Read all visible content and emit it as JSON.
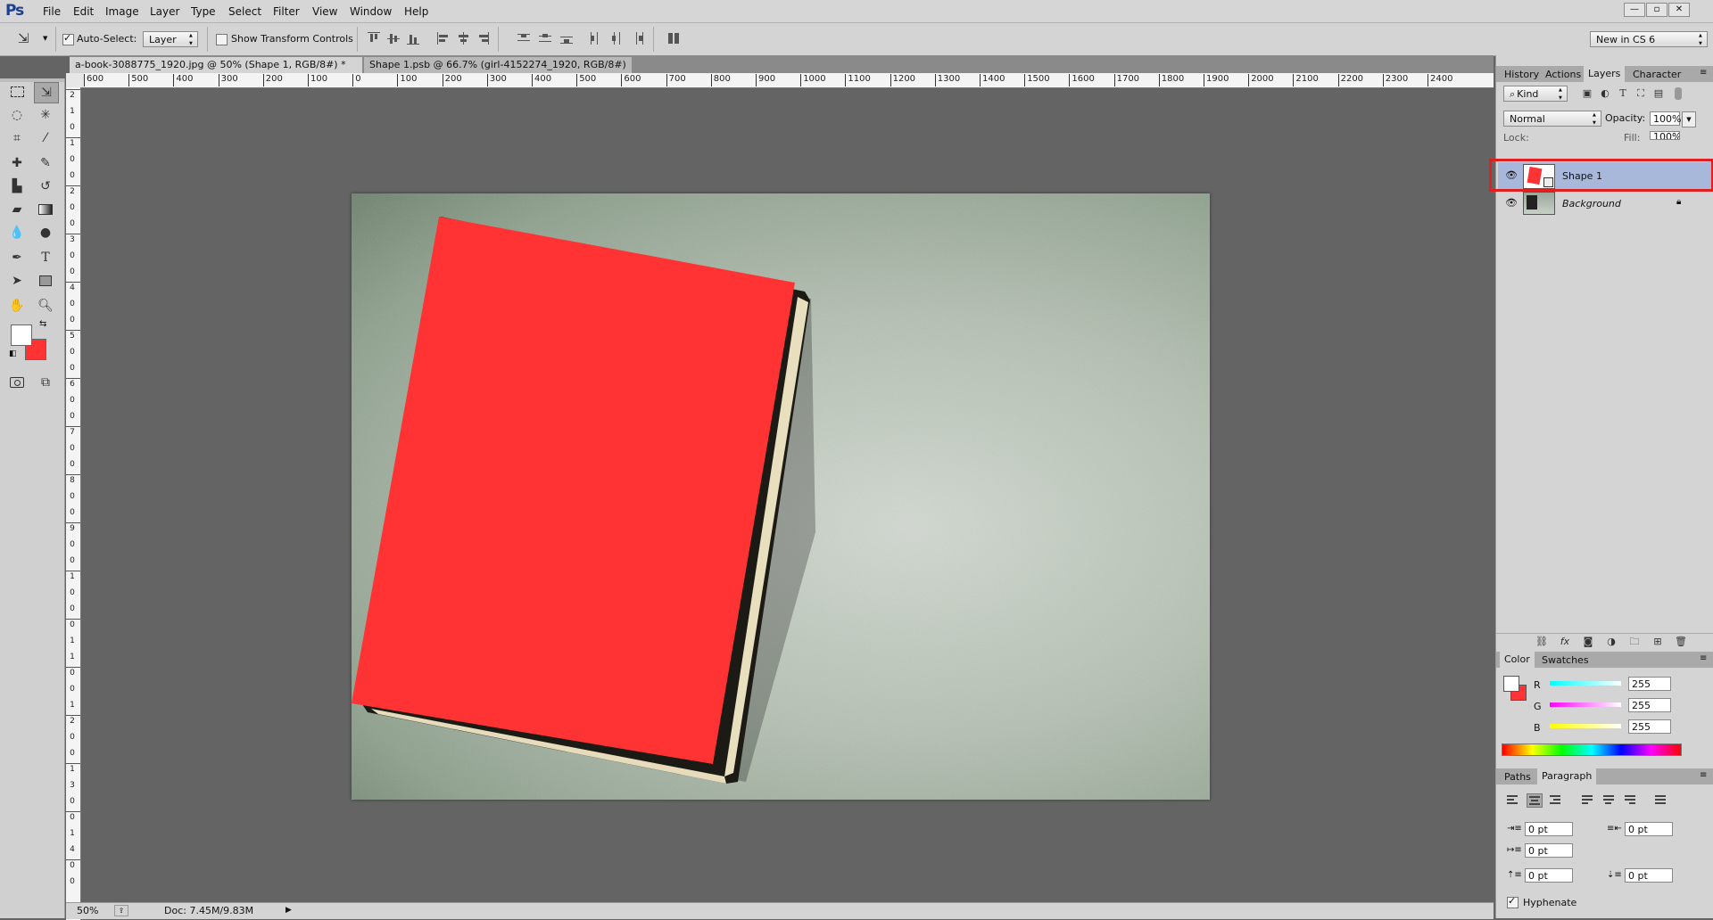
{
  "app": {
    "logo": "Ps"
  },
  "menu": [
    "File",
    "Edit",
    "Image",
    "Layer",
    "Type",
    "Select",
    "Filter",
    "View",
    "Window",
    "Help"
  ],
  "window_controls": [
    "—",
    "▫",
    "✕"
  ],
  "options": {
    "auto_select_label": "Auto-Select:",
    "auto_select_value": "Layer",
    "transform_label": "Show Transform Controls",
    "workspace": "New in CS 6"
  },
  "tabs": [
    {
      "label": "a-book-3088775_1920.jpg @ 50% (Shape 1, RGB/8#) *",
      "close": "×",
      "active": true
    },
    {
      "label": "Shape 1.psb @ 66.7% (girl-4152274_1920, RGB/8#)",
      "close": "×",
      "active": false
    }
  ],
  "ruler": {
    "h": [
      "600",
      "500",
      "400",
      "300",
      "200",
      "100",
      "0",
      "100",
      "200",
      "300",
      "400",
      "500",
      "600",
      "700",
      "800",
      "900",
      "1000",
      "1100",
      "1200",
      "1300",
      "1400",
      "1500",
      "1600",
      "1700",
      "1800",
      "1900",
      "2000",
      "2100",
      "2200",
      "2300",
      "2400"
    ],
    "v": [
      "2",
      "1",
      "0",
      "1",
      "0",
      "0",
      "2",
      "0",
      "0",
      "3",
      "0",
      "0",
      "4",
      "0",
      "0",
      "5",
      "0",
      "0",
      "6",
      "0",
      "0",
      "7",
      "0",
      "0",
      "8",
      "0",
      "0",
      "9",
      "0",
      "0",
      "1",
      "0",
      "0",
      "0",
      "1",
      "1",
      "0",
      "0",
      "1",
      "2",
      "0",
      "0",
      "1",
      "3",
      "0",
      "0",
      "1",
      "4",
      "0",
      "0"
    ]
  },
  "status": {
    "zoom": "50%",
    "doc": "Doc: 7.45M/9.83M"
  },
  "panels": {
    "top_tabs": [
      "History",
      "Actions",
      "Layers",
      "Character"
    ],
    "filter_kind": "Kind",
    "blend_mode": "Normal",
    "opacity_label": "Opacity:",
    "opacity_value": "100%",
    "lock_label": "Lock:",
    "fill_label": "Fill:",
    "fill_value": "100%",
    "layers": [
      {
        "name": "Shape 1",
        "selected": true
      },
      {
        "name": "Background",
        "selected": false
      }
    ],
    "color_tabs": [
      "Color",
      "Swatches"
    ],
    "color": {
      "r_label": "R",
      "g_label": "G",
      "b_label": "B",
      "r": "255",
      "g": "255",
      "b": "255"
    },
    "para_tabs": [
      "Paths",
      "Paragraph"
    ],
    "paragraph": {
      "indent_left": "0 pt",
      "indent_right": "0 pt",
      "first_line": "0 pt",
      "space_before": "0 pt",
      "space_after": "0 pt",
      "hyphenate": "Hyphenate"
    }
  },
  "colors": {
    "book_cover": "#ff3333",
    "foreground": "#ffffff",
    "background": "#ff3333",
    "highlight": "#e02020",
    "layer_selected": "#a8b8db"
  }
}
